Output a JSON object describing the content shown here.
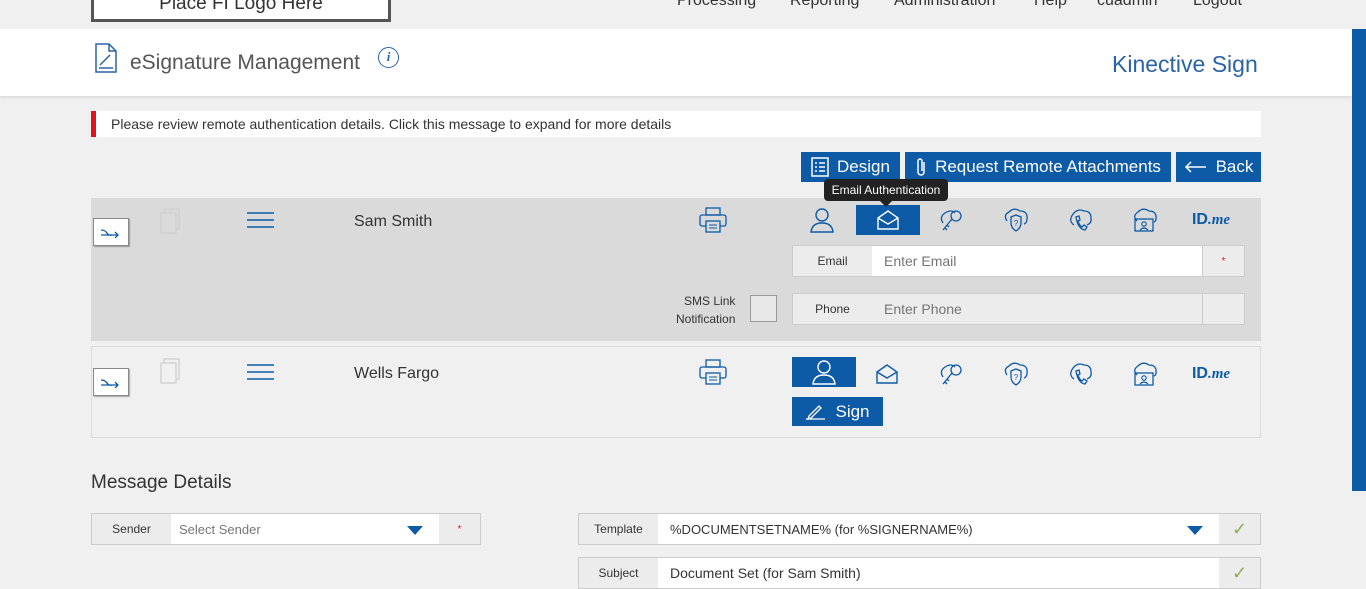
{
  "topnav": {
    "logo": "Place FI Logo Here",
    "items": [
      "Processing",
      "Reporting",
      "Administration",
      "Help",
      "cuadmin",
      "Logout"
    ]
  },
  "header": {
    "title": "eSignature Management",
    "brand": "Kinective Sign"
  },
  "alert": {
    "text": "Please review remote authentication details. Click this message to expand for more details"
  },
  "actions": {
    "design": "Design",
    "request_attachments": "Request Remote Attachments",
    "back": "Back"
  },
  "tooltip": "Email Authentication",
  "signers": [
    {
      "name": "Sam Smith",
      "active_auth": "email",
      "email_label": "Email",
      "email_placeholder": "Enter Email",
      "required_mark": "*",
      "sms_label_line1": "SMS Link",
      "sms_label_line2": "Notification",
      "phone_label": "Phone",
      "phone_placeholder": "Enter Phone"
    },
    {
      "name": "Wells Fargo",
      "active_auth": "user",
      "sign_label": "Sign"
    }
  ],
  "auth_icons": [
    "user-icon",
    "email-icon",
    "key-icon",
    "question-shield-icon",
    "phone-icon",
    "id-card-icon",
    "idme-logo"
  ],
  "idme": {
    "id": "ID",
    "me": ".me"
  },
  "message_details": {
    "title": "Message Details",
    "sender_label": "Sender",
    "sender_placeholder": "Select Sender",
    "required_mark": "*",
    "template_label": "Template",
    "template_value": "%DOCUMENTSETNAME% (for %SIGNERNAME%)",
    "subject_label": "Subject",
    "subject_value": "Document Set (for Sam Smith)",
    "check": "✓"
  },
  "colors": {
    "primary": "#0d5aa7",
    "alert": "#e0141e",
    "valid": "#8fae5a"
  }
}
